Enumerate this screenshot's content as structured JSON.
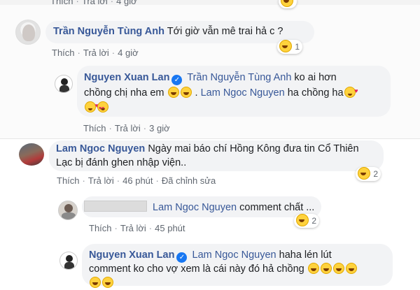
{
  "top_actions": {
    "like": "Thích",
    "reply": "Trả lời",
    "time": "4 giờ"
  },
  "comment1": {
    "author": "Trần Nguyễn Tùng Anh",
    "text": "Tới giờ vẫn mê trai hả c ?",
    "reaction_count": "1",
    "actions": {
      "like": "Thích",
      "reply": "Trả lời",
      "time": "4 giờ"
    }
  },
  "reply1": {
    "author": "Nguyen Xuan Lan",
    "mention1": "Trần Nguyễn Tùng Anh",
    "text_a1": "ko ai hơn",
    "text_a2": "chồng chị nha em",
    "text_b": ".",
    "mention2": "Lam Ngoc Nguyen",
    "text_c": "ha chồng ha",
    "actions": {
      "like": "Thích",
      "reply": "Trả lời",
      "time": "3 giờ"
    }
  },
  "comment2": {
    "author": "Lam Ngoc Nguyen",
    "text_line1": "Ngày mai báo chí Hồng Kông đưa tin Cổ Thiên",
    "text_line2": "Lạc bị đánh ghen nhập viện..",
    "reaction_count": "2",
    "actions": {
      "like": "Thích",
      "reply": "Trả lời",
      "time": "46 phút",
      "edited": "Đã chỉnh sửa"
    }
  },
  "reply2": {
    "mention": "Lam Ngoc Nguyen",
    "text": "comment chất ...",
    "reaction_count": "2",
    "actions": {
      "like": "Thích",
      "reply": "Trả lời",
      "time": "45 phút"
    }
  },
  "reply3": {
    "author": "Nguyen Xuan Lan",
    "mention": "Lam Ngoc Nguyen",
    "text_a": "haha lén lút",
    "text_b": "comment ko cho vợ xem là cái này đó hả chồng"
  },
  "colors": {
    "name": "#385898",
    "bubble": "#f2f3f5",
    "meta": "#606770",
    "verified": "#1877f2"
  },
  "icons": [
    "verified-badge-icon",
    "laughing-emoji-icon",
    "heart-eyes-emoji-icon",
    "smiling-hearts-emoji-icon"
  ]
}
